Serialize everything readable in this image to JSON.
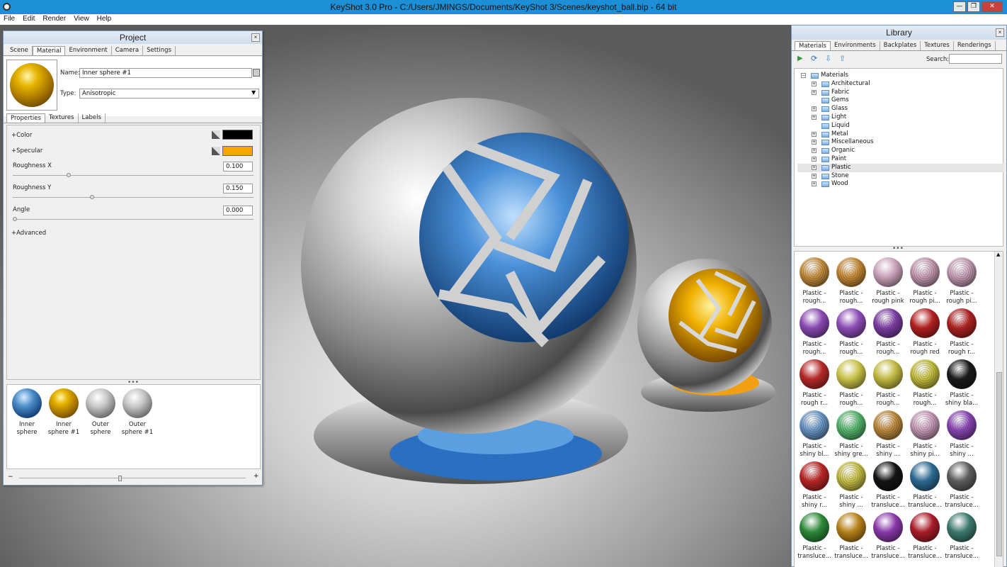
{
  "window": {
    "title": "KeyShot 3.0 Pro  - C:/Users/JMINGS/Documents/KeyShot 3/Scenes/keyshot_ball.bip  - 64 bit",
    "controls": [
      "minimize",
      "maximize",
      "close"
    ]
  },
  "menu": [
    "File",
    "Edit",
    "Render",
    "View",
    "Help"
  ],
  "project": {
    "title": "Project",
    "tabs": [
      "Scene",
      "Material",
      "Environment",
      "Camera",
      "Settings"
    ],
    "active_tab": "Material",
    "name_label": "Name:",
    "name_value": "Inner sphere #1",
    "type_label": "Type:",
    "type_value": "Anisotropic",
    "sub_tabs": [
      "Properties",
      "Textures",
      "Labels"
    ],
    "active_sub_tab": "Properties",
    "color_label": "Color",
    "color_value": "#000000",
    "specular_label": "Specular",
    "specular_value": "#f7a600",
    "roughness_x_label": "Roughness X",
    "roughness_x_value": "0.100",
    "roughness_y_label": "Roughness Y",
    "roughness_y_value": "0.150",
    "angle_label": "Angle",
    "angle_value": "0.000",
    "advanced_label": "Advanced",
    "materials": [
      {
        "line1": "Inner",
        "line2": "sphere",
        "kind": "blue"
      },
      {
        "line1": "Inner",
        "line2": "sphere #1",
        "kind": "gold"
      },
      {
        "line1": "Outer",
        "line2": "sphere",
        "kind": "silver"
      },
      {
        "line1": "Outer",
        "line2": "sphere #1",
        "kind": "silver"
      }
    ]
  },
  "library": {
    "title": "Library",
    "tabs": [
      "Materials",
      "Environments",
      "Backplates",
      "Textures",
      "Renderings"
    ],
    "active_tab": "Materials",
    "search_label": "Search:",
    "search_value": "",
    "root": "Materials",
    "folders": [
      "Architectural",
      "Fabric",
      "Gems",
      "Glass",
      "Light",
      "Liquid",
      "Metal",
      "Miscellaneous",
      "Organic",
      "Paint",
      "Plastic",
      "Stone",
      "Wood"
    ],
    "expandable": [
      true,
      true,
      false,
      true,
      true,
      false,
      true,
      true,
      true,
      true,
      true,
      true,
      true
    ],
    "selected_folder": "Plastic",
    "grid": [
      [
        {
          "line1": "Plastic -",
          "line2": "rough...",
          "color": "#c89040",
          "tex": true
        },
        {
          "line1": "Plastic -",
          "line2": "rough...",
          "color": "#c88c38",
          "tex": true
        },
        {
          "line1": "Plastic -",
          "line2": "rough pink",
          "color": "#c8a0b8",
          "tex": false
        },
        {
          "line1": "Plastic -",
          "line2": "rough pi...",
          "color": "#c89cb4",
          "tex": true
        },
        {
          "line1": "Plastic -",
          "line2": "rough pi...",
          "color": "#c8a0b8",
          "tex": true
        }
      ],
      [
        {
          "line1": "Plastic -",
          "line2": "rough...",
          "color": "#8848b0",
          "tex": false
        },
        {
          "line1": "Plastic -",
          "line2": "rough...",
          "color": "#8c4cb4",
          "tex": false
        },
        {
          "line1": "Plastic -",
          "line2": "rough...",
          "color": "#8040a8",
          "tex": true
        },
        {
          "line1": "Plastic -",
          "line2": "rough red",
          "color": "#b02020",
          "tex": false
        },
        {
          "line1": "Plastic -",
          "line2": "rough r...",
          "color": "#b42424",
          "tex": true
        }
      ],
      [
        {
          "line1": "Plastic -",
          "line2": "rough r...",
          "color": "#b42828",
          "tex": false
        },
        {
          "line1": "Plastic -",
          "line2": "rough...",
          "color": "#c8c048",
          "tex": false
        },
        {
          "line1": "Plastic -",
          "line2": "rough...",
          "color": "#c0b840",
          "tex": false
        },
        {
          "line1": "Plastic -",
          "line2": "rough...",
          "color": "#c8c040",
          "tex": true
        },
        {
          "line1": "Plastic -",
          "line2": "shiny bla...",
          "color": "#1c1c1c",
          "tex": true
        }
      ],
      [
        {
          "line1": "Plastic -",
          "line2": "shiny bl...",
          "color": "#6c98c8",
          "tex": true
        },
        {
          "line1": "Plastic -",
          "line2": "shiny gre...",
          "color": "#58b870",
          "tex": true
        },
        {
          "line1": "Plastic -",
          "line2": "shiny ...",
          "color": "#c08c40",
          "tex": true
        },
        {
          "line1": "Plastic -",
          "line2": "shiny pi...",
          "color": "#c89cb8",
          "tex": true
        },
        {
          "line1": "Plastic -",
          "line2": "shiny ...",
          "color": "#8c48b8",
          "tex": true
        }
      ],
      [
        {
          "line1": "Plastic -",
          "line2": "shiny r...",
          "color": "#c02828",
          "tex": true
        },
        {
          "line1": "Plastic -",
          "line2": "shiny ...",
          "color": "#c8c048",
          "tex": true
        },
        {
          "line1": "Plastic -",
          "line2": "transluce...",
          "color": "#141414",
          "tex": false
        },
        {
          "line1": "Plastic -",
          "line2": "transluce...",
          "color": "#2c6890",
          "tex": false
        },
        {
          "line1": "Plastic -",
          "line2": "transluce...",
          "color": "#5c5c5c",
          "tex": false
        }
      ],
      [
        {
          "line1": "Plastic -",
          "line2": "transluce...",
          "color": "#2c8838",
          "tex": false
        },
        {
          "line1": "Plastic -",
          "line2": "transluce...",
          "color": "#b48018",
          "tex": false
        },
        {
          "line1": "Plastic -",
          "line2": "transluce...",
          "color": "#8838a8",
          "tex": false
        },
        {
          "line1": "Plastic -",
          "line2": "transluce...",
          "color": "#a81c28",
          "tex": false
        },
        {
          "line1": "Plastic -",
          "line2": "transluce...",
          "color": "#3c786c",
          "tex": false
        }
      ]
    ]
  }
}
